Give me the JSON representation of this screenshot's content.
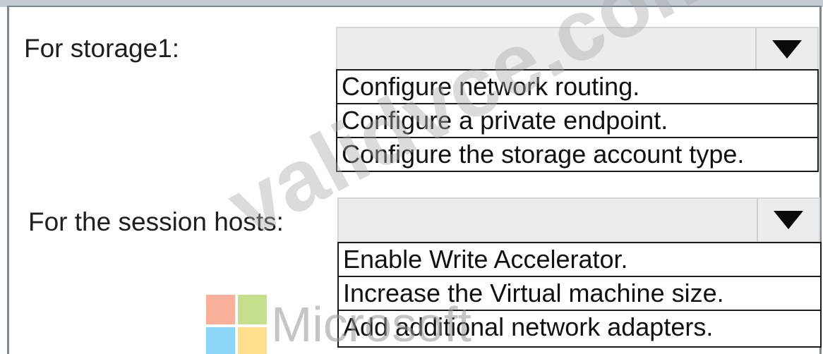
{
  "rows": [
    {
      "label": "For storage1:",
      "selected_value": "",
      "options": [
        "Configure network routing.",
        "Configure a private endpoint.",
        "Configure the storage account type."
      ]
    },
    {
      "label": "For the session hosts:",
      "selected_value": "",
      "options": [
        "Enable Write Accelerator.",
        "Increase the Virtual machine size.",
        "Add additional network adapters."
      ]
    }
  ],
  "watermark": {
    "text": "validvce.com"
  },
  "logo": {
    "text": "Microsoft",
    "colors": [
      "#f25022",
      "#7fba00",
      "#00a4ef",
      "#ffb900"
    ]
  }
}
